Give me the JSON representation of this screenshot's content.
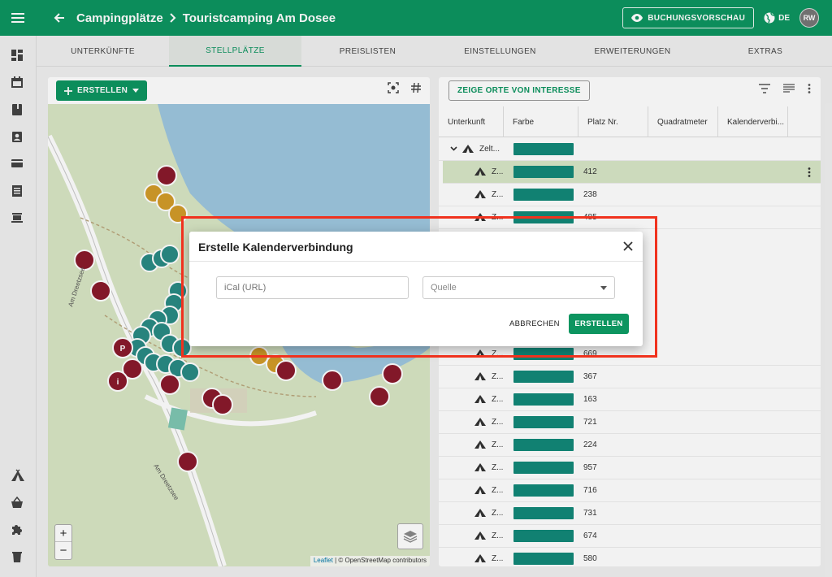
{
  "header": {
    "breadcrumb_parent": "Campingplätze",
    "breadcrumb_current": "Touristcamping Am Dosee",
    "preview_label": "BUCHUNGSVORSCHAU",
    "language": "DE",
    "user_initials": "RW"
  },
  "tabs": [
    {
      "label": "UNTERKÜNFTE"
    },
    {
      "label": "STELLPLÄTZE"
    },
    {
      "label": "PREISLISTEN"
    },
    {
      "label": "EINSTELLUNGEN"
    },
    {
      "label": "ERWEITERUNGEN"
    },
    {
      "label": "EXTRAS"
    }
  ],
  "active_tab": "STELLPLÄTZE",
  "map": {
    "create_label": "ERSTELLEN",
    "street_label": "Am Dreetzsee",
    "attribution_leaflet": "Leaflet",
    "attribution_rest": "| © OpenStreetMap contributors",
    "zoom_in": "+",
    "zoom_out": "−"
  },
  "table": {
    "poi_button": "ZEIGE ORTE VON INTERESSE",
    "columns": [
      "Unterkunft",
      "Farbe",
      "Platz Nr.",
      "Quadratmeter",
      "Kalenderverbi..."
    ],
    "group_label": "Zelt...",
    "row_prefix": "Z...",
    "rows": [
      "412",
      "238",
      "485",
      "669",
      "367",
      "163",
      "721",
      "224",
      "957",
      "716",
      "731",
      "674",
      "580"
    ],
    "selected_row": "412"
  },
  "dialog": {
    "title": "Erstelle Kalenderverbindung",
    "ical_placeholder": "iCal (URL)",
    "source_placeholder": "Quelle",
    "cancel_label": "ABBRECHEN",
    "create_label": "ERSTELLEN"
  },
  "colors": {
    "primary": "#0d9560",
    "swatch": "#128879",
    "selected_row": "#d7e6c7",
    "highlight_frame": "#f0321e"
  }
}
